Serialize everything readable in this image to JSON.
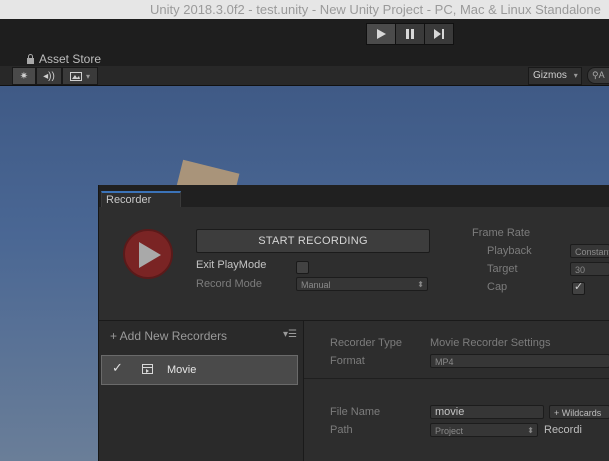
{
  "window": {
    "title": "Unity 2018.3.0f2 - test.unity - New Unity Project - PC, Mac & Linux Standalone"
  },
  "toolbar": {
    "play_icon": "play-icon",
    "pause_icon": "pause-icon",
    "step_icon": "step-icon",
    "asset_store_label": "Asset Store"
  },
  "scene_toolbar": {
    "light_icon": "sun-icon",
    "audio_icon": "audio-icon",
    "image_icon": "image-icon",
    "gizmos_label": "Gizmos",
    "search_placeholder": "A"
  },
  "recorder": {
    "tab_label": "Recorder",
    "start_recording_label": "START RECORDING",
    "exit_playmode_label": "Exit PlayMode",
    "exit_playmode_checked": false,
    "record_mode_label": "Record Mode",
    "record_mode_value": "Manual",
    "frame_rate_label": "Frame Rate",
    "playback_label": "Playback",
    "playback_value": "Constant",
    "target_label": "Target",
    "target_value": "30",
    "cap_label": "Cap",
    "cap_checked": true,
    "add_new_recorders_label": "+ Add New Recorders",
    "recorders": [
      {
        "name": "Movie",
        "enabled": true
      }
    ],
    "recorder_type_label": "Recorder Type",
    "recorder_type_value": "Movie Recorder Settings",
    "format_label": "Format",
    "format_value": "MP4",
    "file_name_label": "File Name",
    "file_name_value": "movie",
    "wildcards_label": "+ Wildcards",
    "path_label": "Path",
    "path_value": "Project",
    "path_folder_value": "Recordi"
  },
  "colors": {
    "accent_tab": "#3b73b8",
    "record_button": "#7a2424",
    "scene_sky": "#4a6794"
  }
}
